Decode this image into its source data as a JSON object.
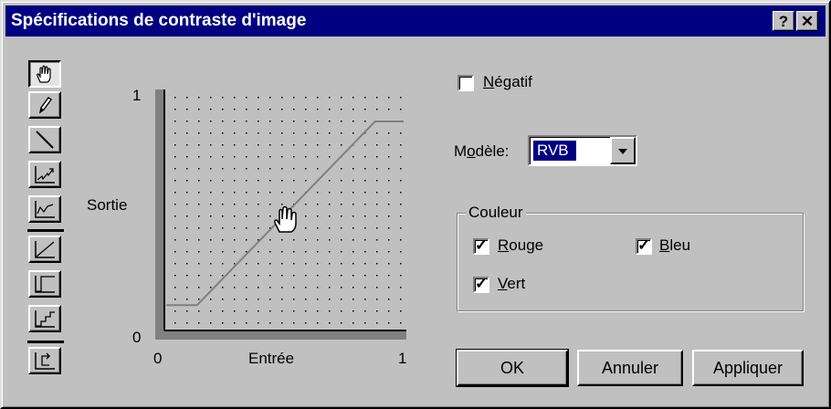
{
  "window": {
    "title": "Spécifications de contraste d'image",
    "help_label": "?",
    "close_label": "✕"
  },
  "tools": [
    {
      "name": "hand-tool",
      "icon": "hand-icon",
      "active": true
    },
    {
      "name": "pencil-tool",
      "icon": "pencil-icon"
    },
    {
      "name": "line-tool",
      "icon": "diagonal-line-icon"
    },
    {
      "name": "curve-tool-1",
      "icon": "curve-graph-icon"
    },
    {
      "name": "curve-tool-2",
      "icon": "curve-graph-icon"
    },
    {
      "name": "preset-linear",
      "icon": "linear-curve-icon"
    },
    {
      "name": "preset-threshold",
      "icon": "threshold-curve-icon"
    },
    {
      "name": "preset-steps",
      "icon": "posterize-curve-icon"
    },
    {
      "name": "reset-tool",
      "icon": "reset-icon"
    }
  ],
  "graph": {
    "xlabel": "Entrée",
    "ylabel": "Sortie",
    "x_min": "0",
    "x_max": "1",
    "y_min": "0",
    "y_max": "1",
    "curve": [
      [
        0,
        0.1
      ],
      [
        0.13,
        0.1
      ],
      [
        0.88,
        0.88
      ],
      [
        1,
        0.88
      ]
    ]
  },
  "negative": {
    "label_pre": "",
    "label_u": "N",
    "label_post": "égatif",
    "checked": false
  },
  "model": {
    "label_pre": "M",
    "label_u": "o",
    "label_post": "dèle:",
    "value": "RVB"
  },
  "colors": {
    "title": "Couleur",
    "red": {
      "label_u": "R",
      "label_post": "ouge",
      "checked": true
    },
    "blue": {
      "label_u": "B",
      "label_post": "leu",
      "checked": true
    },
    "green": {
      "label_u": "V",
      "label_post": "ert",
      "checked": true
    }
  },
  "buttons": {
    "ok": "OK",
    "cancel": "Annuler",
    "apply": "Appliquer"
  }
}
